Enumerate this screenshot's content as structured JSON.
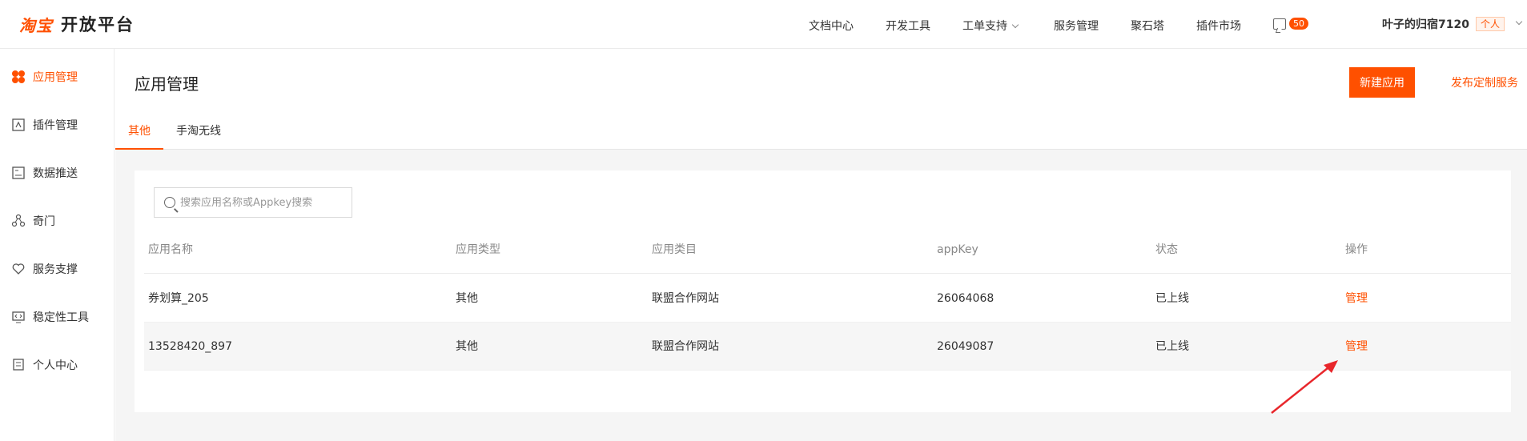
{
  "header": {
    "logo_mark": "淘宝",
    "title": "开放平台",
    "nav": [
      "文档中心",
      "开发工具",
      "工单支持",
      "服务管理",
      "聚石塔",
      "插件市场"
    ],
    "message_count": "50",
    "user_name": "叶子的归宿7120",
    "user_tag": "个人"
  },
  "sidebar": {
    "items": [
      {
        "label": "应用管理",
        "icon": "apps-icon"
      },
      {
        "label": "插件管理",
        "icon": "plugin-icon"
      },
      {
        "label": "数据推送",
        "icon": "data-push-icon"
      },
      {
        "label": "奇门",
        "icon": "qimen-icon"
      },
      {
        "label": "服务支撑",
        "icon": "heart-icon"
      },
      {
        "label": "稳定性工具",
        "icon": "code-monitor-icon"
      },
      {
        "label": "个人中心",
        "icon": "profile-icon"
      }
    ]
  },
  "main": {
    "title": "应用管理",
    "new_app_button": "新建应用",
    "publish_link": "发布定制服务",
    "tabs": [
      "其他",
      "手淘无线"
    ],
    "search_placeholder": "搜索应用名称或Appkey搜索",
    "table": {
      "headers": [
        "应用名称",
        "应用类型",
        "应用类目",
        "appKey",
        "状态",
        "操作"
      ],
      "rows": [
        {
          "name": "券划算_205",
          "type": "其他",
          "category": "联盟合作网站",
          "appkey": "26064068",
          "status": "已上线",
          "action": "管理"
        },
        {
          "name": "13528420_897",
          "type": "其他",
          "category": "联盟合作网站",
          "appkey": "26049087",
          "status": "已上线",
          "action": "管理"
        }
      ]
    }
  },
  "colors": {
    "accent": "#ff5000",
    "annotation_arrow": "#e8262b"
  }
}
